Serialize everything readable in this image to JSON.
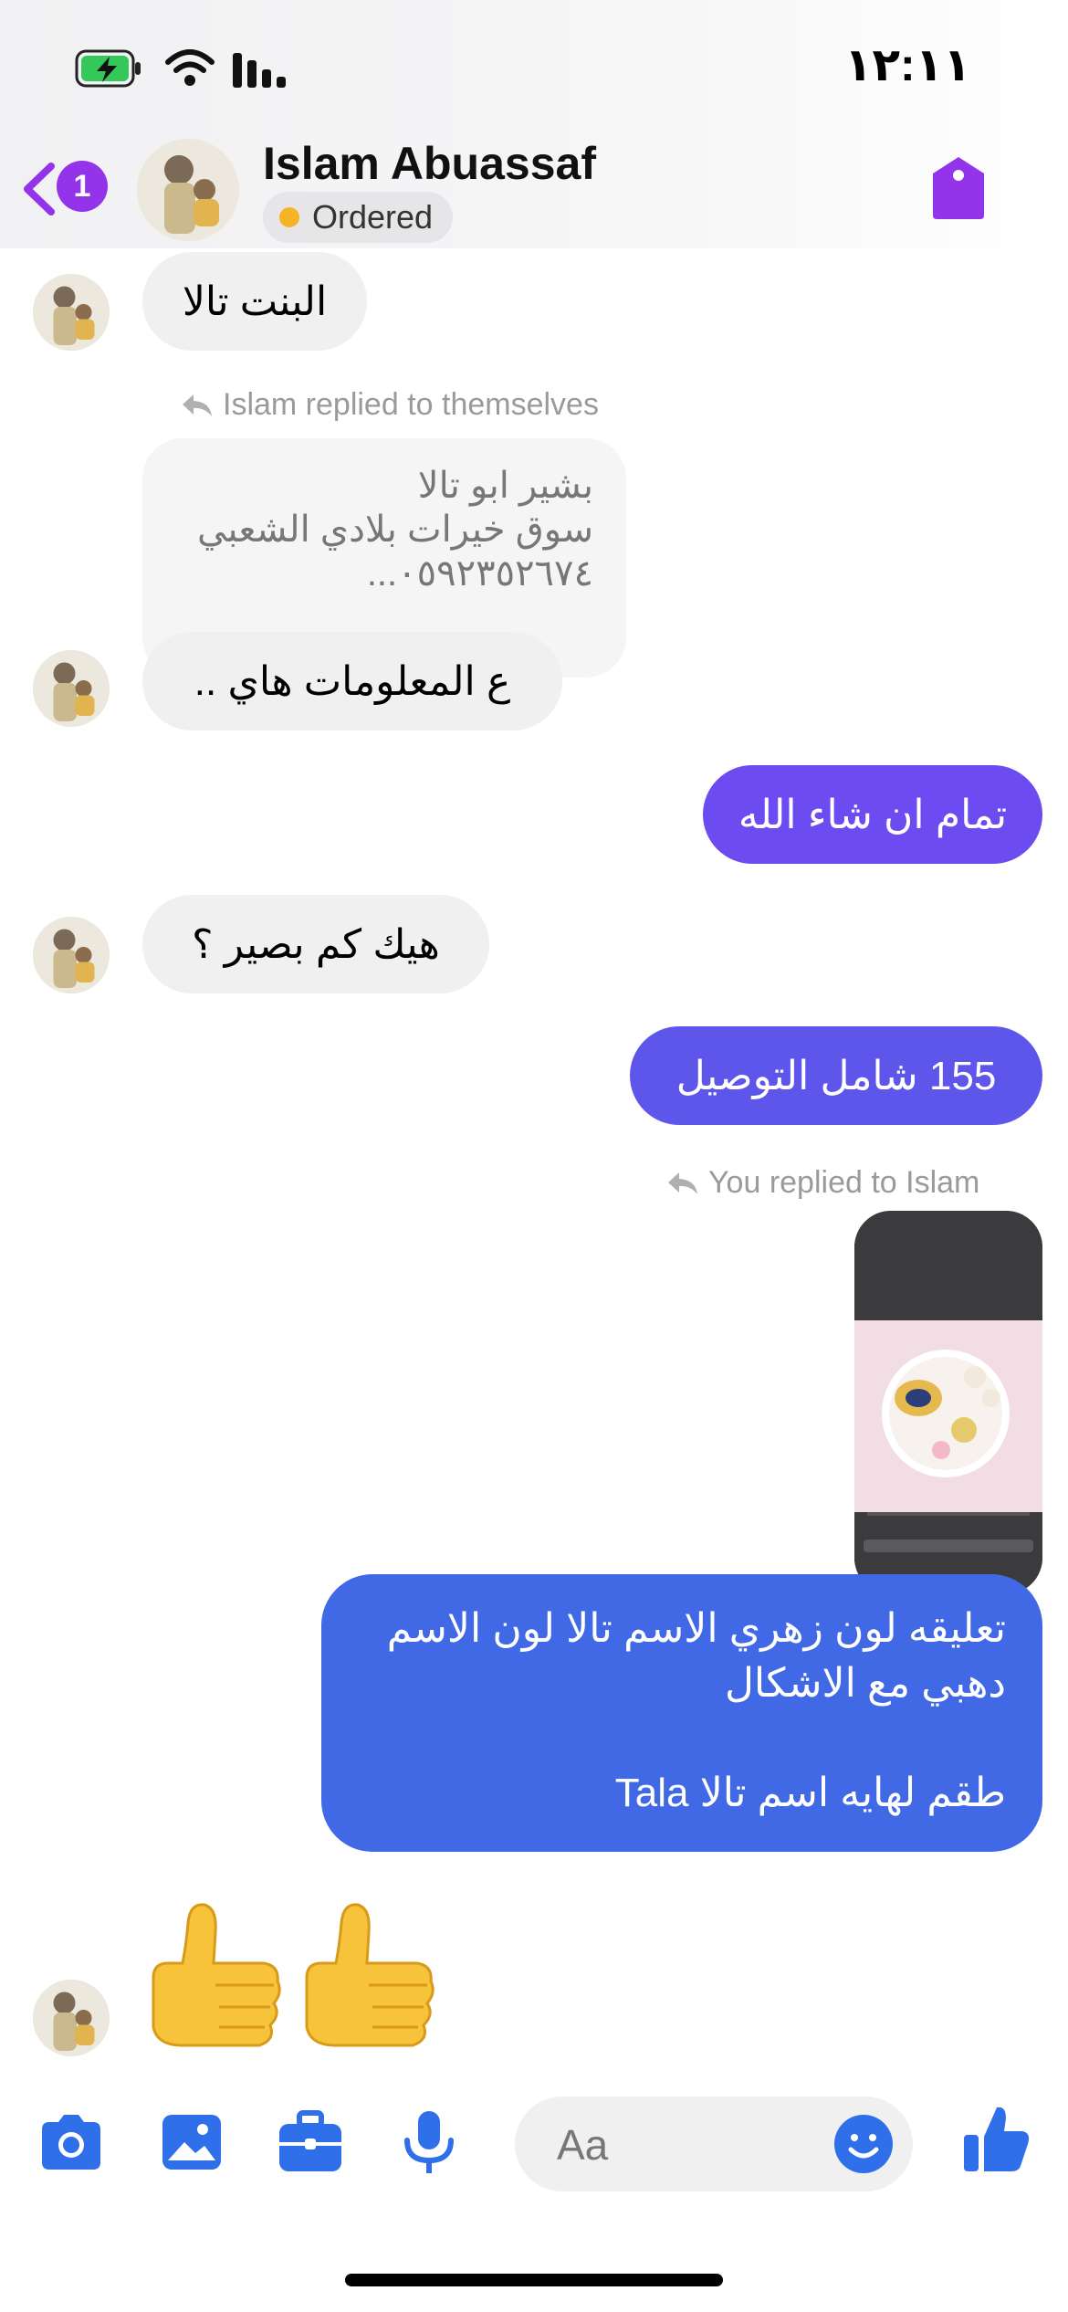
{
  "status_bar": {
    "time": "١٢:١١"
  },
  "header": {
    "back_badge": "1",
    "contact_name": "Islam Abuassaf",
    "status_label": "Ordered",
    "status_dot_color": "#f5b325",
    "accent": "#9333ea",
    "icons": [
      "back-chevron-icon",
      "tag-icon"
    ]
  },
  "messages": {
    "m1": {
      "text": "البنت تالا"
    },
    "reply_note_1": "Islam replied to themselves",
    "quoted_lines": [
      "بشير ابو تالا",
      "سوق خيرات بلادي الشعبي",
      "٠٥٩٢٣٥٢٦٧٤..."
    ],
    "m2": {
      "text": "ع المعلومات هاي .."
    },
    "m3": {
      "text": "تمام ان شاء الله"
    },
    "m4": {
      "text": "هيك كم بصير ؟"
    },
    "m5": {
      "text": "155 شامل التوصيل"
    },
    "reply_note_2": "You replied to Islam",
    "m6_lines": [
      "تعليقه لون زهري الاسم تالا لون الاسم",
      "دهبي مع الاشكال",
      "",
      "طقم لهايه اسم تالا Tala"
    ],
    "reaction": "👍👍"
  },
  "colors": {
    "incoming_bubble": "#f0f0f0",
    "outgoing_purple": "#6c4cf1",
    "outgoing_violet": "#5e56ea",
    "outgoing_blue": "#4169e6",
    "toolbar_icon": "#2f6fea"
  },
  "composer": {
    "placeholder": "Aa",
    "tools": [
      "camera-icon",
      "gallery-icon",
      "briefcase-icon",
      "microphone-icon",
      "emoji-icon",
      "thumbs-up-icon"
    ]
  }
}
